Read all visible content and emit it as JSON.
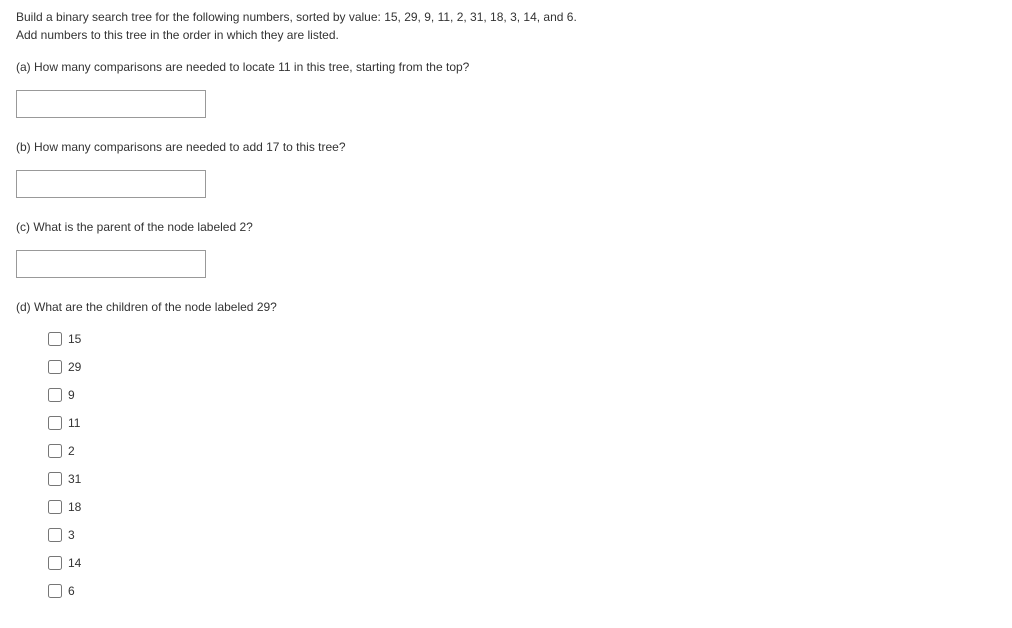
{
  "intro_line1": "Build a binary search tree for the following numbers, sorted by value: 15, 29, 9, 11, 2, 31, 18, 3, 14, and 6.",
  "intro_line2": "Add numbers to this tree in the order in which they are listed.",
  "question_a": "(a) How many comparisons are needed to locate 11 in this tree, starting from the top?",
  "question_b": "(b) How many comparisons are needed to add 17 to this tree?",
  "question_c": "(c) What is the parent of the node labeled 2?",
  "question_d": "(d) What are the children of the node labeled 29?",
  "input_a": "",
  "input_b": "",
  "input_c": "",
  "checkbox_options": {
    "opt0": "15",
    "opt1": "29",
    "opt2": "9",
    "opt3": "11",
    "opt4": "2",
    "opt5": "31",
    "opt6": "18",
    "opt7": "3",
    "opt8": "14",
    "opt9": "6"
  }
}
